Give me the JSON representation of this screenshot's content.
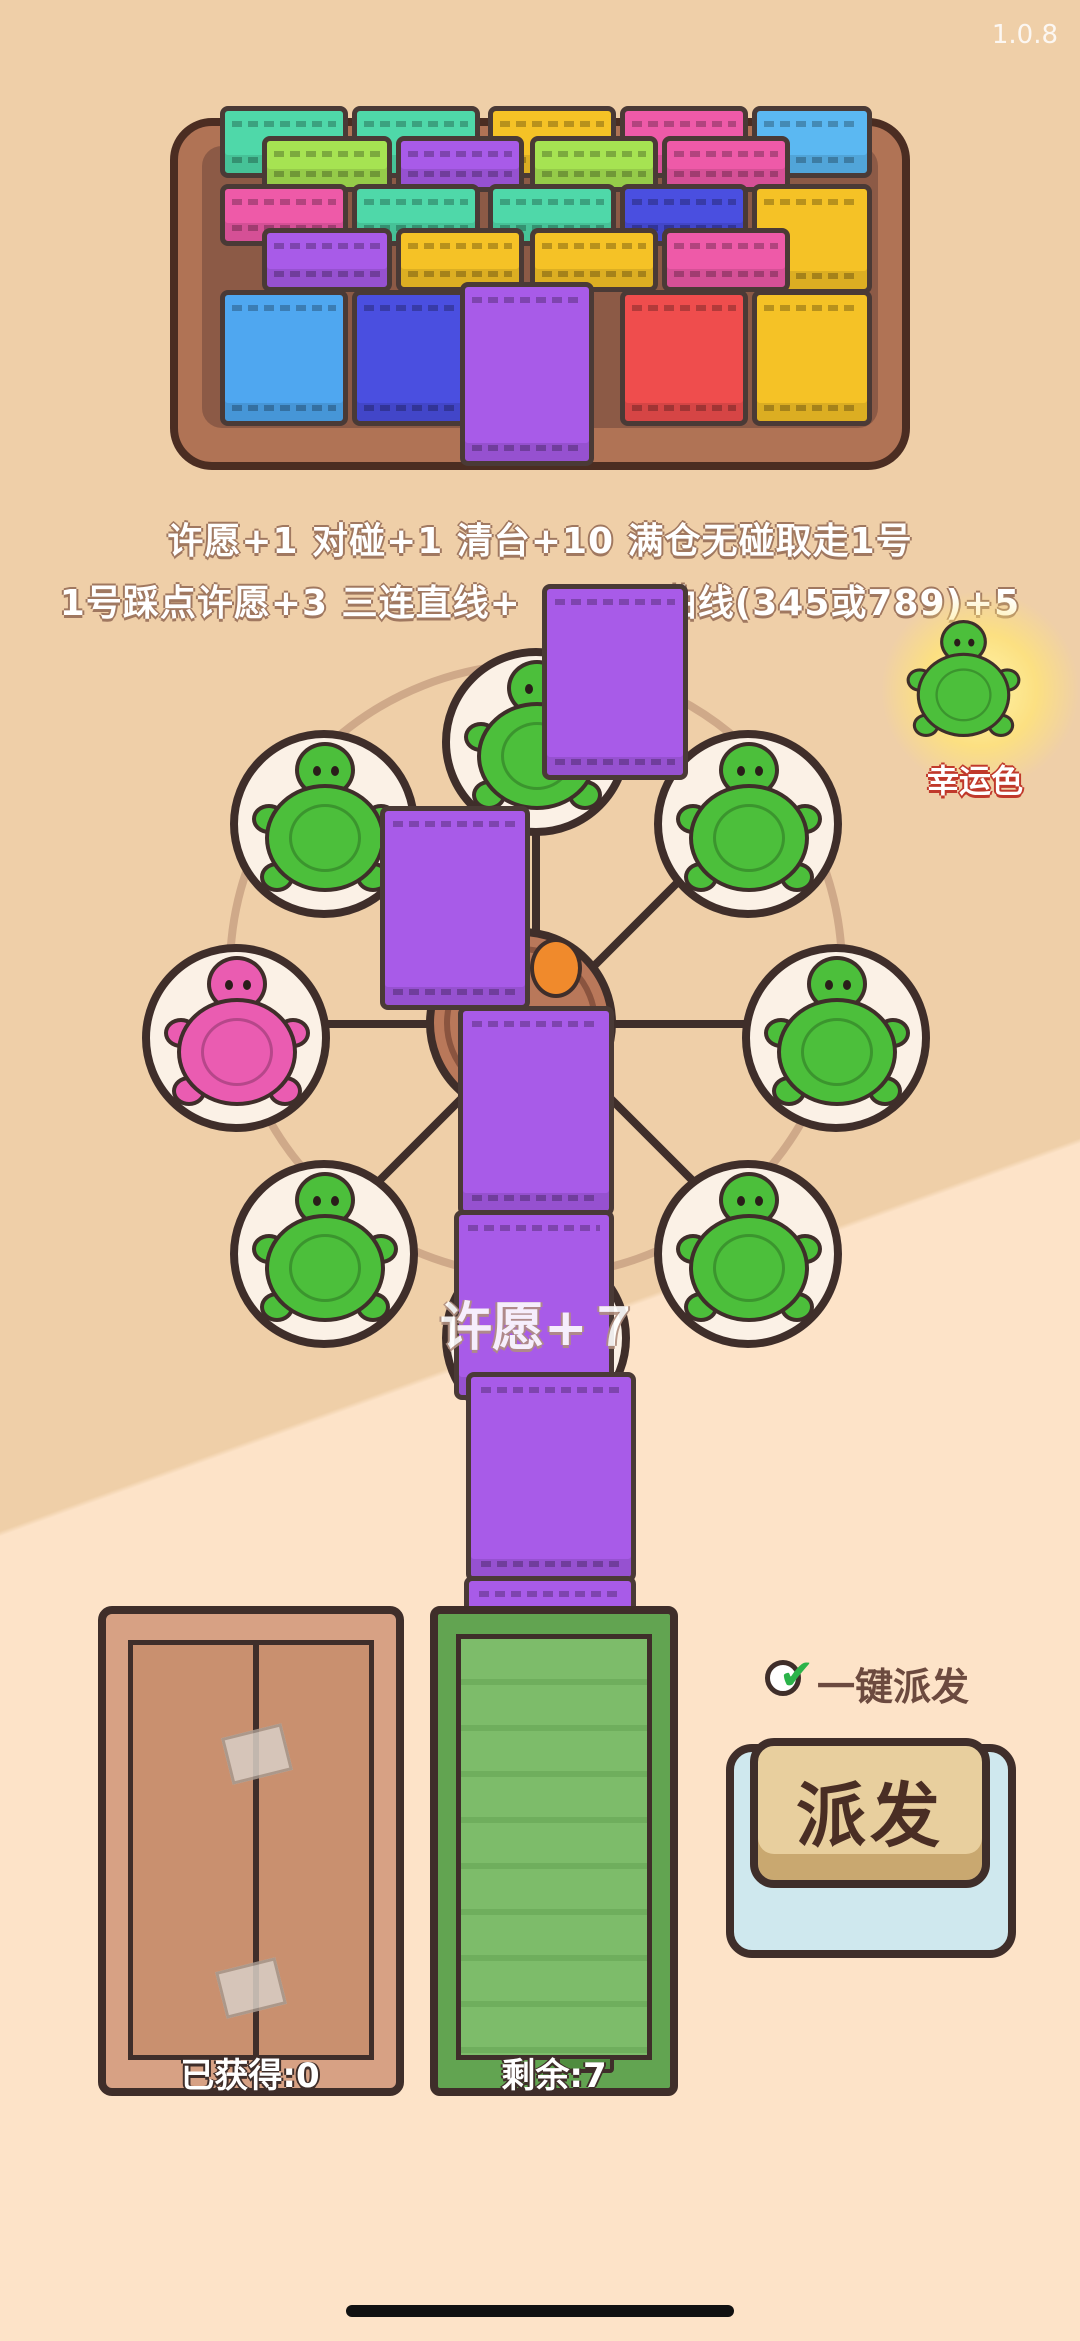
{
  "version": "1.0.8",
  "rules": {
    "line1": "许愿+1 对碰+1 清台+10 满仓无碰取走1号",
    "line2": "1号踩点许愿+3 三连直线+",
    "line2_tail": "曲线(345或789)+5"
  },
  "lucky": {
    "label": "幸运色",
    "color": "#4cbf3b"
  },
  "float_text": "许愿+７",
  "wheel": {
    "seat_colors": [
      "#4cbf3b",
      "#4cbf3b",
      "#4cbf3b",
      "#4cbf3b",
      "#4cbf3b",
      "#4cbf3b",
      "#ea5cb1",
      "#4cbf3b"
    ]
  },
  "obtained_box": {
    "label": "已获得:0"
  },
  "remaining_box": {
    "label": "剩余:7"
  },
  "auto_dispatch": {
    "label": "一键派发",
    "checked": true
  },
  "dispatch_button": {
    "label": "派发"
  },
  "colors": {
    "purple_bag": "#a85be8",
    "accent_brown": "#3f2e2a"
  }
}
